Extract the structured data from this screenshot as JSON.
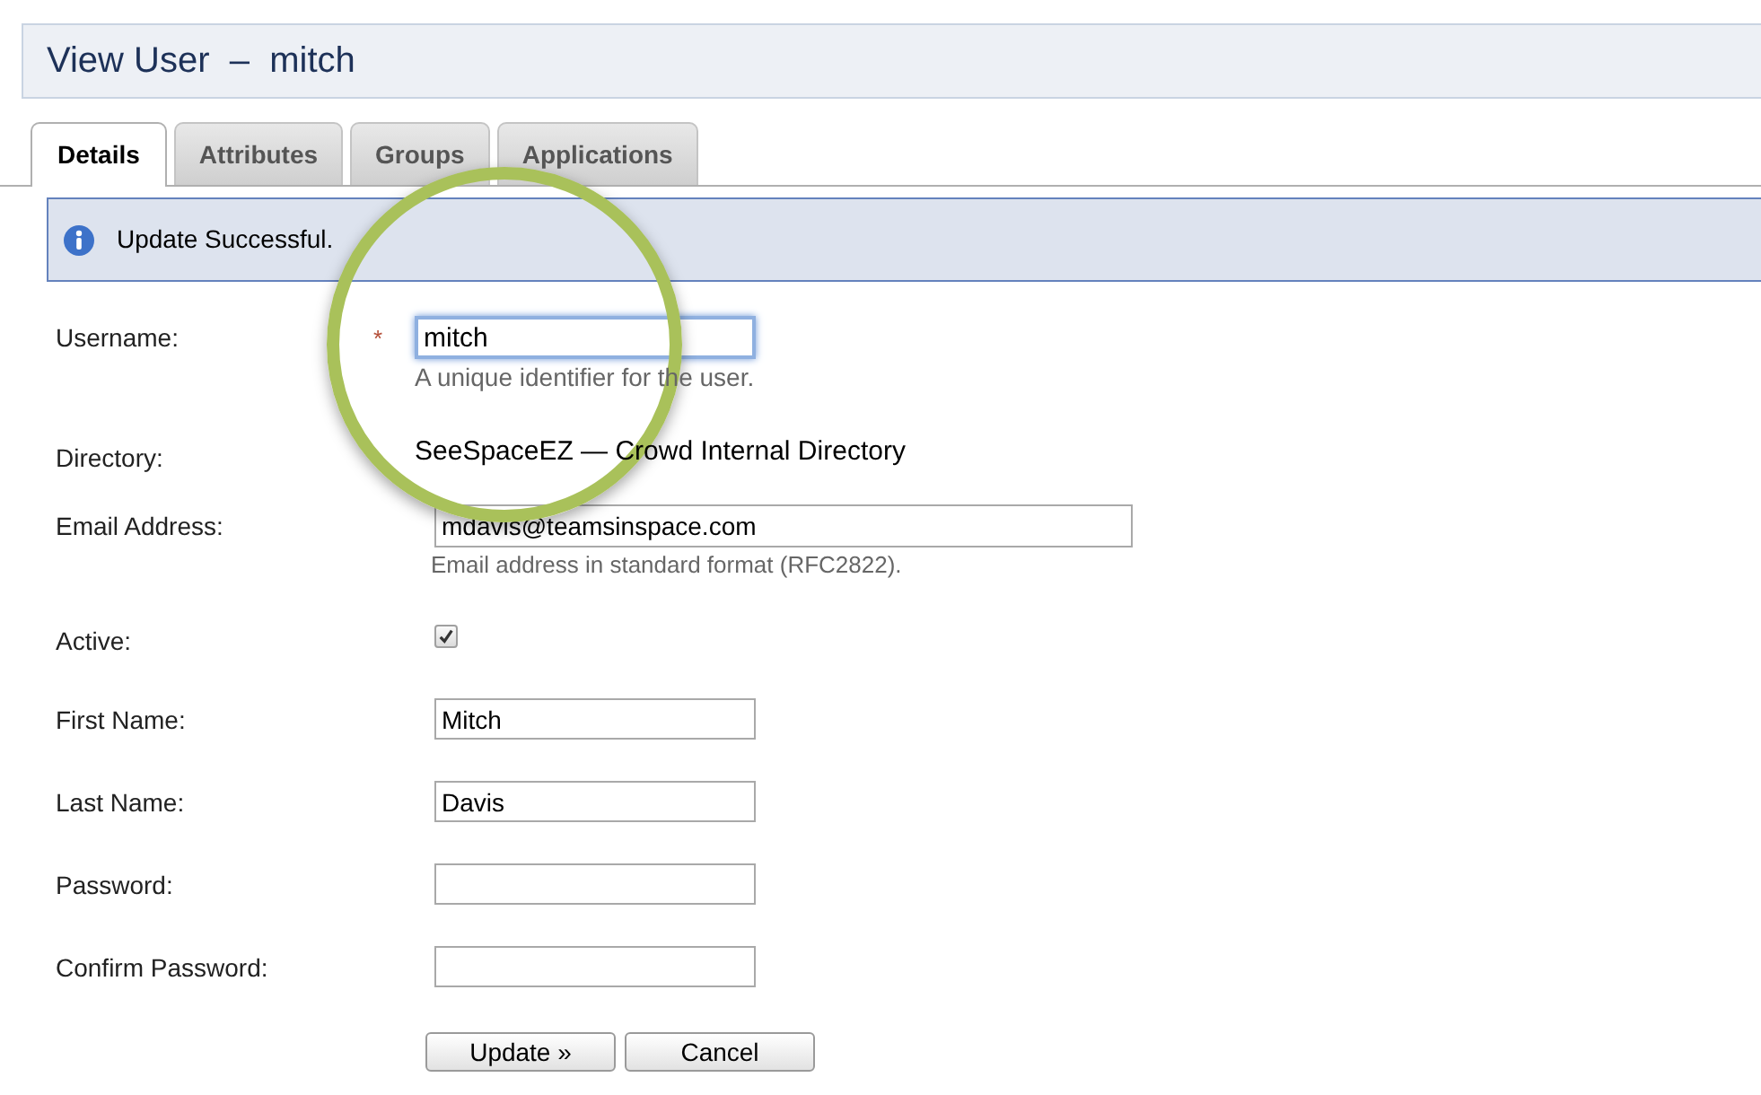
{
  "page": {
    "title": "View User  –  mitch"
  },
  "tabs": [
    {
      "label": "Details",
      "selected": true
    },
    {
      "label": "Attributes",
      "selected": false
    },
    {
      "label": "Groups",
      "selected": false
    },
    {
      "label": "Applications",
      "selected": false
    }
  ],
  "message": {
    "text": "Update Successful."
  },
  "fields": [
    {
      "kind": "text",
      "label": "Username:",
      "required": true,
      "required_mark": "*",
      "value": "mitch",
      "hint": "A unique identifier for the user.",
      "focused": true
    },
    {
      "kind": "static",
      "label": "Directory:",
      "value": "SeeSpaceEZ — Crowd Internal Directory"
    },
    {
      "kind": "wide",
      "label": "Email Address:",
      "value": "mdavis@teamsinspace.com",
      "hint": "Email address in standard format (RFC2822)."
    },
    {
      "kind": "checkbox",
      "label": "Active:",
      "checked": true
    },
    {
      "kind": "text",
      "label": "First Name:",
      "value": "Mitch"
    },
    {
      "kind": "text",
      "label": "Last Name:",
      "value": "Davis"
    },
    {
      "kind": "text",
      "label": "Password:"
    },
    {
      "kind": "text",
      "label": "Confirm Password:"
    }
  ],
  "buttons": [
    "Update »",
    "Cancel"
  ]
}
